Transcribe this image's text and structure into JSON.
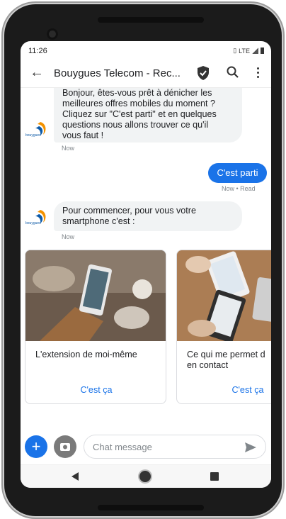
{
  "status_bar": {
    "time": "11:26",
    "network": "LTE"
  },
  "toolbar": {
    "title": "Bouygues Telecom - Rec..."
  },
  "messages": [
    {
      "from": "bot",
      "text_lines": [
        "Bonjour, êtes-vous prêt à dénicher les",
        "meilleures offres mobiles du moment ?",
        "Cliquez sur \"C'est parti\" et en quelques",
        "questions nous allons trouver ce qu'il",
        "vous faut !"
      ],
      "time": "Now"
    },
    {
      "from": "user",
      "text": "C'est parti",
      "time": "Now • Read"
    },
    {
      "from": "bot",
      "text_lines": [
        "Pour commencer, pour vous votre",
        "smartphone c'est :"
      ],
      "time": "Now"
    }
  ],
  "avatar": {
    "brand_text": "bouygues"
  },
  "cards": [
    {
      "title_lines": [
        "L'extension de moi-même"
      ],
      "button": "C'est ça"
    },
    {
      "title_lines": [
        "Ce qui me permet d",
        "en contact"
      ],
      "button": "C'est ça"
    }
  ],
  "composer": {
    "placeholder": "Chat message"
  },
  "colors": {
    "accent": "#1a73e8",
    "bubble_bot": "#f1f3f4",
    "brand_orange": "#f39200",
    "brand_blue": "#0d5aa7"
  },
  "icons": [
    "back-arrow-icon",
    "shield-check-icon",
    "search-icon",
    "more-vert-icon",
    "plus-icon",
    "gallery-icon",
    "send-icon",
    "nav-back-icon",
    "nav-home-icon",
    "nav-recent-icon"
  ]
}
